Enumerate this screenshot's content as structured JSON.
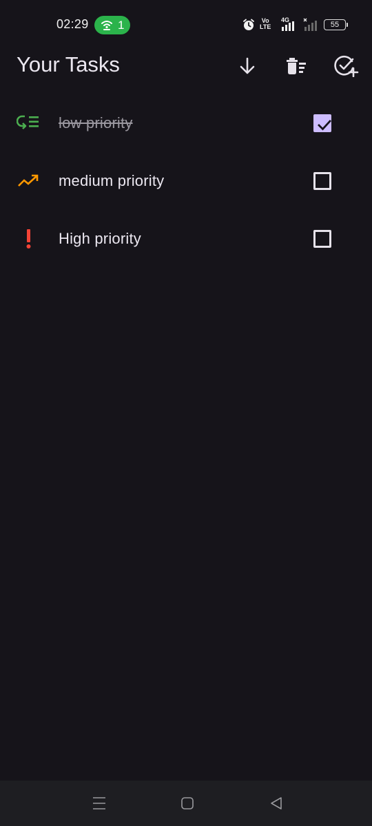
{
  "status_bar": {
    "time": "02:29",
    "hotspot_count": "1",
    "volte_top": "Vo",
    "volte_bottom": "LTE",
    "network_type": "4G",
    "battery_level": "55",
    "hotspot_color": "#2bb34b"
  },
  "header": {
    "title": "Your Tasks",
    "actions": [
      {
        "icon": "arrow-down-icon",
        "name": "sort"
      },
      {
        "icon": "delete-sweep-icon",
        "name": "clear-completed"
      },
      {
        "icon": "add-task-icon",
        "name": "add-task"
      }
    ]
  },
  "tasks": [
    {
      "label": "low priority",
      "priority": "low",
      "icon": "low-priority-icon",
      "icon_color": "#4caf50",
      "completed": true
    },
    {
      "label": "medium priority",
      "priority": "medium",
      "icon": "trending-up-icon",
      "icon_color": "#ff9800",
      "completed": false
    },
    {
      "label": "High priority",
      "priority": "high",
      "icon": "priority-high-icon",
      "icon_color": "#f44336",
      "completed": false
    }
  ],
  "colors": {
    "background": "#16141a",
    "accent": "#cdbdff",
    "nav_bar": "#1e1e22"
  },
  "nav_bar": {
    "buttons": [
      "menu-icon",
      "home-icon",
      "back-icon"
    ]
  }
}
